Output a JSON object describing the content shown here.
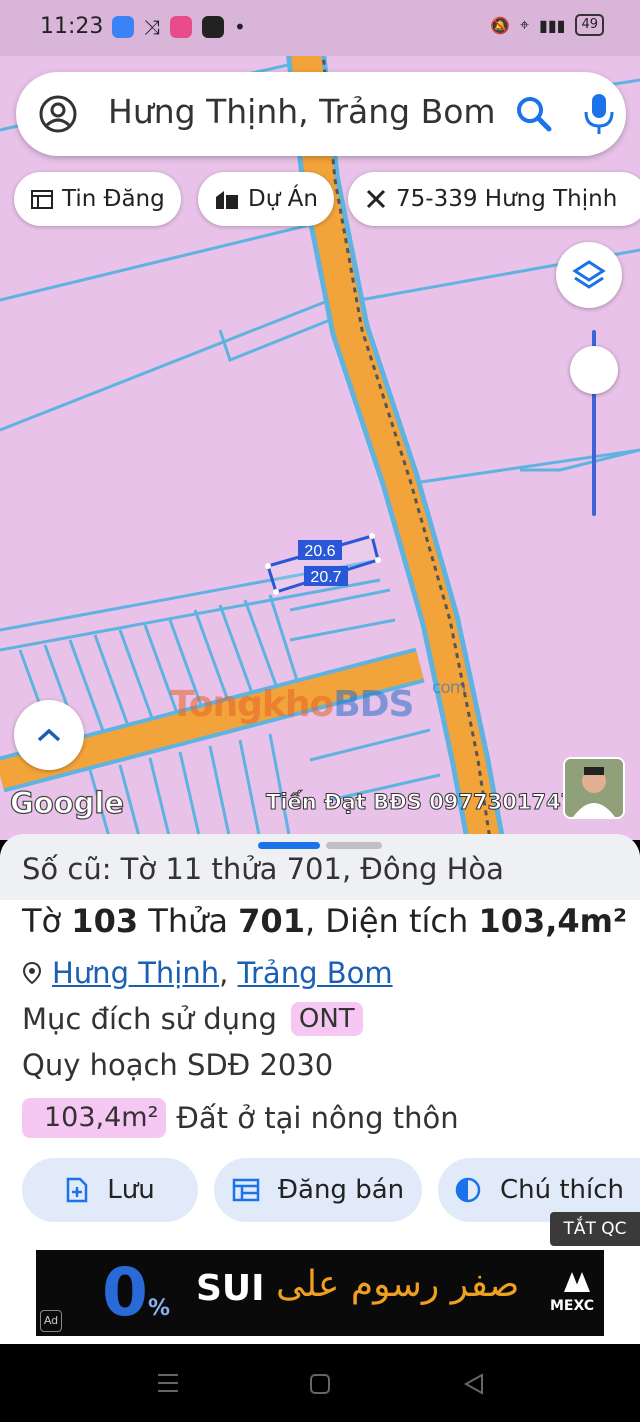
{
  "status_bar": {
    "time": "11:23",
    "battery": "49",
    "icons": [
      "mute-icon",
      "location-icon",
      "signal-4g-icon",
      "battery-icon"
    ]
  },
  "search": {
    "value": "Hưng Thịnh, Trảng Bom"
  },
  "chips": [
    {
      "label": "Tin Đăng",
      "icon": "calendar-icon"
    },
    {
      "label": "Dự Án",
      "icon": "building-icon"
    },
    {
      "label": "75-339 Hưng Thịnh",
      "icon": "tools-icon"
    }
  ],
  "map": {
    "parcel_labels": [
      "20.6",
      "20.7"
    ],
    "google_label": "Google",
    "watermark": "Tiến Đạt BĐS 0977301747",
    "site_logo": {
      "part1": "Tongkho",
      "part2": "BDS",
      "suffix": "com"
    }
  },
  "sheet": {
    "old_info": "Số cũ: Tờ 11 thửa 701, Đông Hòa",
    "parcel": {
      "to_label": "Tờ",
      "to_value": "103",
      "thua_label": "Thửa",
      "thua_value": "701",
      "area_label": "Diện tích",
      "area_value": "103,4m²"
    },
    "location": {
      "ward": "Hưng Thịnh",
      "district": "Trảng Bom",
      "separator": ","
    },
    "purpose_label": "Mục đích sử dụng",
    "purpose_code": "ONT",
    "plan_label": "Quy hoạch SDĐ 2030",
    "area_badge": "103,4m²",
    "area_desc": "Đất ở tại nông thôn",
    "actions": [
      {
        "label": "Lưu",
        "icon": "add-doc-icon"
      },
      {
        "label": "Đăng bán",
        "icon": "calendar-icon"
      },
      {
        "label": "Chú thích",
        "icon": "contrast-icon"
      }
    ]
  },
  "ad": {
    "tag": "TẮT QC",
    "zero": "0",
    "percent": "%",
    "sui": "SUI",
    "arabic": "صفر رسوم على",
    "brand": "MEXC",
    "ad_mark": "Ad"
  },
  "colors": {
    "map_bg": "#e8c2e8",
    "road": "#f2a33a",
    "parcel_line": "#5fb3e0",
    "accent": "#1a73e8",
    "badge": "#f6c7f2"
  }
}
